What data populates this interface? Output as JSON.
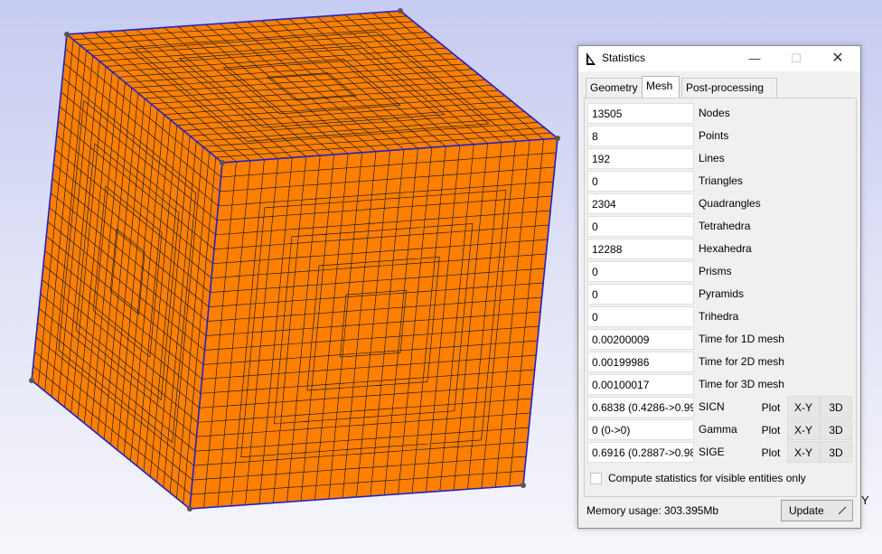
{
  "axis": {
    "label": "Y"
  },
  "colors": {
    "mesh_face": "#ff7f00",
    "mesh_edge": "#202020",
    "cube_edge": "#2020c8",
    "vertex": "#555555"
  },
  "window": {
    "title": "Statistics",
    "controls": {
      "minimize": "—",
      "maximize": "☐",
      "close": "✕"
    }
  },
  "tabs": [
    {
      "label": "Geometry",
      "active": false
    },
    {
      "label": "Mesh",
      "active": true
    },
    {
      "label": "Post-processing",
      "active": false
    }
  ],
  "stats": [
    {
      "value": "13505",
      "label": "Nodes"
    },
    {
      "value": "8",
      "label": "Points"
    },
    {
      "value": "192",
      "label": "Lines"
    },
    {
      "value": "0",
      "label": "Triangles"
    },
    {
      "value": "2304",
      "label": "Quadrangles"
    },
    {
      "value": "0",
      "label": "Tetrahedra"
    },
    {
      "value": "12288",
      "label": "Hexahedra"
    },
    {
      "value": "0",
      "label": "Prisms"
    },
    {
      "value": "0",
      "label": "Pyramids"
    },
    {
      "value": "0",
      "label": "Trihedra"
    },
    {
      "value": "0.00200009",
      "label": "Time for 1D mesh"
    },
    {
      "value": "0.00199986",
      "label": "Time for 2D mesh"
    },
    {
      "value": "0.00100017",
      "label": "Time for 3D mesh"
    },
    {
      "value": "0.6838 (0.4286->0.99",
      "label": "SICN"
    },
    {
      "value": "0 (0->0)",
      "label": "Gamma"
    },
    {
      "value": "0.6916 (0.2887->0.98",
      "label": "SIGE"
    }
  ],
  "plot_buttons": {
    "plot": "Plot",
    "xy": "X-Y",
    "d3": "3D"
  },
  "checkbox": {
    "label": "Compute statistics for visible entities only",
    "checked": false
  },
  "footer": {
    "memory": "Memory usage: 303.395Mb",
    "update": "Update"
  }
}
